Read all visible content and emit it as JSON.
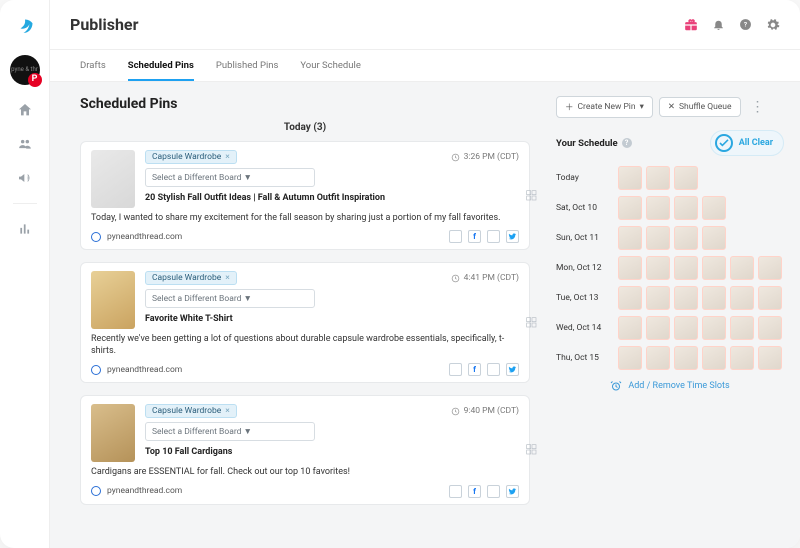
{
  "header": {
    "title": "Publisher"
  },
  "tabs": [
    "Drafts",
    "Scheduled Pins",
    "Published Pins",
    "Your Schedule"
  ],
  "active_tab": "Scheduled Pins",
  "section_title": "Scheduled Pins",
  "group_label": "Today (3)",
  "board_selector_text": "Select a Different Board ▼",
  "board_chip": "Capsule Wardrobe",
  "source": "pyneandthread.com",
  "pins": [
    {
      "time": "3:26 PM (CDT)",
      "title": "20 Stylish Fall Outfit Ideas | Fall & Autumn Outfit Inspiration",
      "desc": "Today, I wanted to share my excitement for the fall season by sharing just a portion of my fall favorites."
    },
    {
      "time": "4:41 PM (CDT)",
      "title": "Favorite White T-Shirt",
      "desc": "Recently we've been getting a lot of questions about durable capsule wardrobe essentials, specifically, t-shirts."
    },
    {
      "time": "9:40 PM (CDT)",
      "title": "Top 10 Fall Cardigans",
      "desc": "Cardigans are ESSENTIAL for fall. Check out our top 10 favorites!"
    }
  ],
  "side_actions": {
    "create": "Create New Pin",
    "shuffle": "Shuffle Queue"
  },
  "schedule_header": "Your Schedule",
  "all_clear": "All Clear",
  "schedule": [
    {
      "label": "Today",
      "count": 3
    },
    {
      "label": "Sat, Oct 10",
      "count": 4
    },
    {
      "label": "Sun, Oct 11",
      "count": 4
    },
    {
      "label": "Mon, Oct 12",
      "count": 6
    },
    {
      "label": "Tue, Oct 13",
      "count": 6
    },
    {
      "label": "Wed, Oct 14",
      "count": 6
    },
    {
      "label": "Thu, Oct 15",
      "count": 6
    }
  ],
  "add_remove": "Add / Remove Time Slots",
  "icons": {
    "gift": "gift-icon",
    "bell": "bell-icon",
    "help": "help-icon",
    "gear": "gear-icon"
  }
}
